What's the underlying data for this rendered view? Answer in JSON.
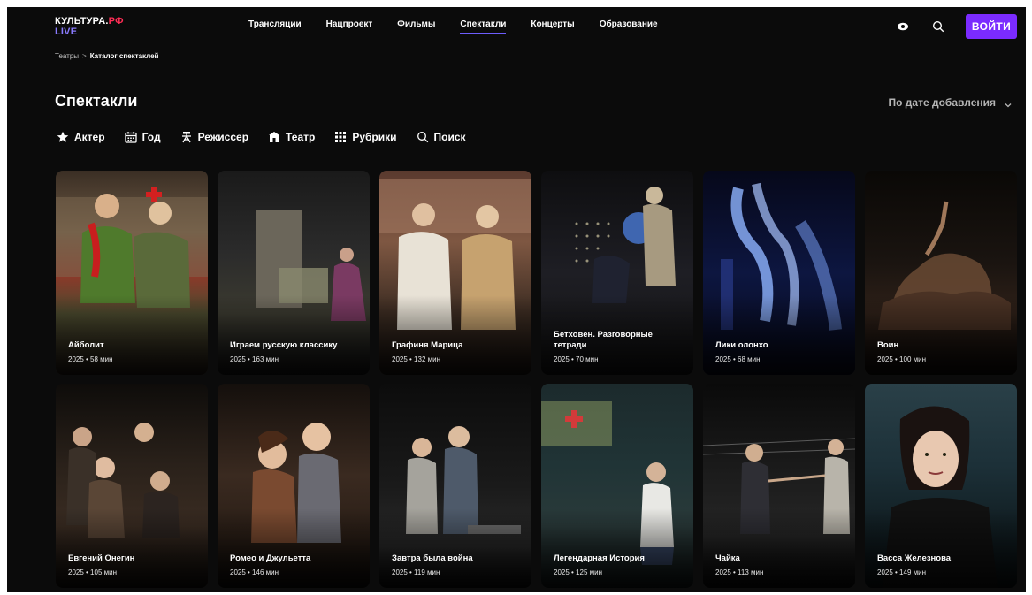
{
  "logo": {
    "main": "КУЛЬТУРА.",
    "accent": "РФ",
    "sub": "LIVE"
  },
  "nav": [
    "Трансляции",
    "Нацпроект",
    "Фильмы",
    "Спектакли",
    "Концерты",
    "Образование"
  ],
  "nav_active": "Спектакли",
  "header_right": {
    "login_label": "ВОЙТИ",
    "icons": [
      "eye-icon",
      "search-icon"
    ]
  },
  "breadcrumb": {
    "root": "Театры",
    "separator": ">",
    "current": "Каталог спектаклей"
  },
  "page_title": "Спектакли",
  "sort_label": "По дате добавления",
  "filters": [
    {
      "label": "Актер",
      "icon": "star-icon"
    },
    {
      "label": "Год",
      "icon": "calendar-icon"
    },
    {
      "label": "Режиссер",
      "icon": "director-icon"
    },
    {
      "label": "Театр",
      "icon": "theater-icon"
    },
    {
      "label": "Рубрики",
      "icon": "grid-icon"
    },
    {
      "label": "Поиск",
      "icon": "search-icon"
    }
  ],
  "cards": [
    {
      "title": "Айболит",
      "meta": "2025 • 58 мин"
    },
    {
      "title": "Играем русскую классику",
      "meta": "2025 • 163 мин"
    },
    {
      "title": "Графиня Марица",
      "meta": "2025 • 132 мин"
    },
    {
      "title": "Бетховен. Разговорные тетради",
      "meta": "2025 • 70 мин"
    },
    {
      "title": "Лики олонхо",
      "meta": "2025 • 68 мин"
    },
    {
      "title": "Воин",
      "meta": "2025 • 100 мин"
    },
    {
      "title": "Евгений Онегин",
      "meta": "2025 • 105 мин"
    },
    {
      "title": "Ромео и Джульетта",
      "meta": "2025 • 146 мин"
    },
    {
      "title": "Завтра была война",
      "meta": "2025 • 119 мин"
    },
    {
      "title": "Легендарная История",
      "meta": "2025 • 125 мин"
    },
    {
      "title": "Чайка",
      "meta": "2025 • 113 мин"
    },
    {
      "title": "Васса Железнова",
      "meta": "2025 • 149 мин"
    }
  ],
  "colors": {
    "accent": "#7b2bff",
    "logo_accent": "#ff2d55",
    "active_underline": "#6d5dfc",
    "background": "#0b0b0b"
  }
}
